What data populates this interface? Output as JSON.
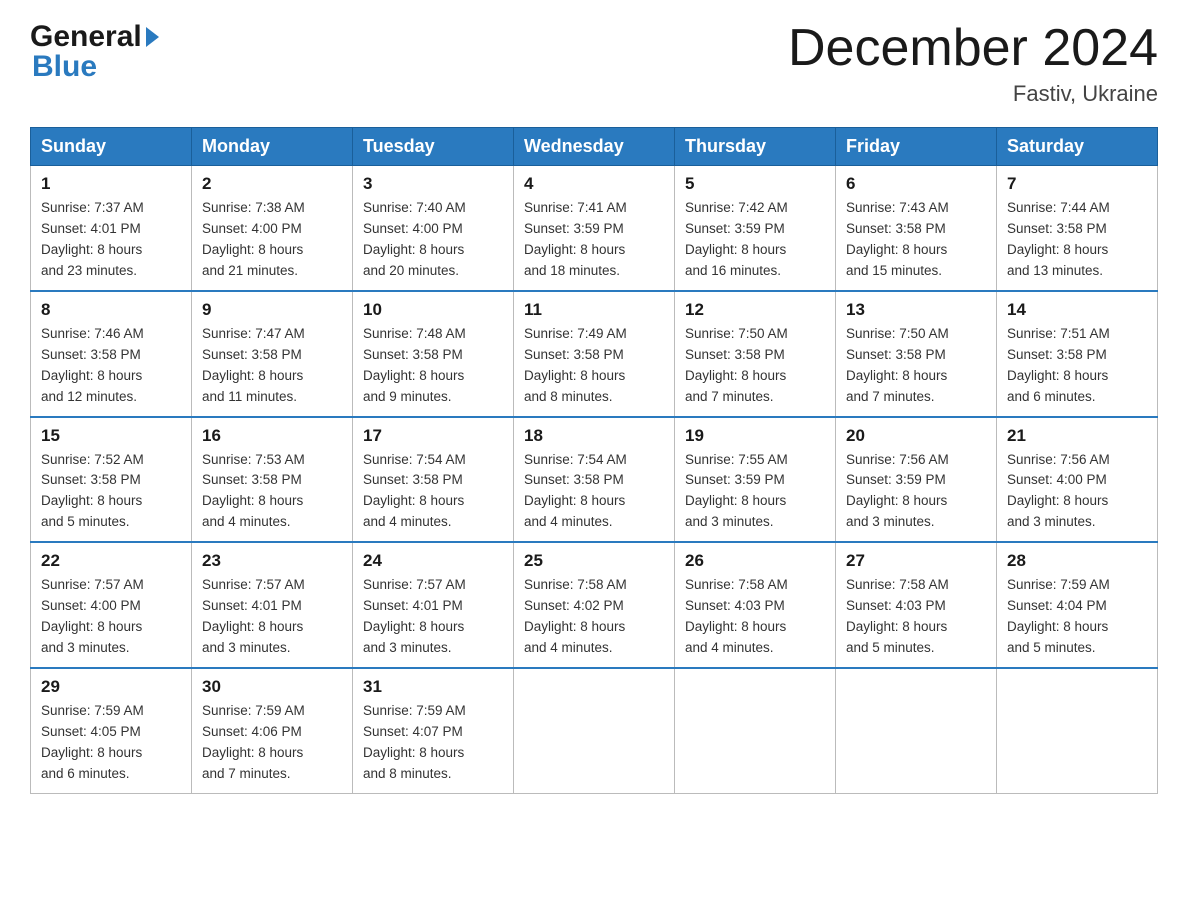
{
  "header": {
    "logo": {
      "general": "General",
      "blue": "Blue",
      "arrow": "▶"
    },
    "title": "December 2024",
    "location": "Fastiv, Ukraine"
  },
  "calendar": {
    "days_of_week": [
      "Sunday",
      "Monday",
      "Tuesday",
      "Wednesday",
      "Thursday",
      "Friday",
      "Saturday"
    ],
    "weeks": [
      [
        {
          "day": "1",
          "sunrise": "7:37 AM",
          "sunset": "4:01 PM",
          "daylight": "8 hours and 23 minutes."
        },
        {
          "day": "2",
          "sunrise": "7:38 AM",
          "sunset": "4:00 PM",
          "daylight": "8 hours and 21 minutes."
        },
        {
          "day": "3",
          "sunrise": "7:40 AM",
          "sunset": "4:00 PM",
          "daylight": "8 hours and 20 minutes."
        },
        {
          "day": "4",
          "sunrise": "7:41 AM",
          "sunset": "3:59 PM",
          "daylight": "8 hours and 18 minutes."
        },
        {
          "day": "5",
          "sunrise": "7:42 AM",
          "sunset": "3:59 PM",
          "daylight": "8 hours and 16 minutes."
        },
        {
          "day": "6",
          "sunrise": "7:43 AM",
          "sunset": "3:58 PM",
          "daylight": "8 hours and 15 minutes."
        },
        {
          "day": "7",
          "sunrise": "7:44 AM",
          "sunset": "3:58 PM",
          "daylight": "8 hours and 13 minutes."
        }
      ],
      [
        {
          "day": "8",
          "sunrise": "7:46 AM",
          "sunset": "3:58 PM",
          "daylight": "8 hours and 12 minutes."
        },
        {
          "day": "9",
          "sunrise": "7:47 AM",
          "sunset": "3:58 PM",
          "daylight": "8 hours and 11 minutes."
        },
        {
          "day": "10",
          "sunrise": "7:48 AM",
          "sunset": "3:58 PM",
          "daylight": "8 hours and 9 minutes."
        },
        {
          "day": "11",
          "sunrise": "7:49 AM",
          "sunset": "3:58 PM",
          "daylight": "8 hours and 8 minutes."
        },
        {
          "day": "12",
          "sunrise": "7:50 AM",
          "sunset": "3:58 PM",
          "daylight": "8 hours and 7 minutes."
        },
        {
          "day": "13",
          "sunrise": "7:50 AM",
          "sunset": "3:58 PM",
          "daylight": "8 hours and 7 minutes."
        },
        {
          "day": "14",
          "sunrise": "7:51 AM",
          "sunset": "3:58 PM",
          "daylight": "8 hours and 6 minutes."
        }
      ],
      [
        {
          "day": "15",
          "sunrise": "7:52 AM",
          "sunset": "3:58 PM",
          "daylight": "8 hours and 5 minutes."
        },
        {
          "day": "16",
          "sunrise": "7:53 AM",
          "sunset": "3:58 PM",
          "daylight": "8 hours and 4 minutes."
        },
        {
          "day": "17",
          "sunrise": "7:54 AM",
          "sunset": "3:58 PM",
          "daylight": "8 hours and 4 minutes."
        },
        {
          "day": "18",
          "sunrise": "7:54 AM",
          "sunset": "3:58 PM",
          "daylight": "8 hours and 4 minutes."
        },
        {
          "day": "19",
          "sunrise": "7:55 AM",
          "sunset": "3:59 PM",
          "daylight": "8 hours and 3 minutes."
        },
        {
          "day": "20",
          "sunrise": "7:56 AM",
          "sunset": "3:59 PM",
          "daylight": "8 hours and 3 minutes."
        },
        {
          "day": "21",
          "sunrise": "7:56 AM",
          "sunset": "4:00 PM",
          "daylight": "8 hours and 3 minutes."
        }
      ],
      [
        {
          "day": "22",
          "sunrise": "7:57 AM",
          "sunset": "4:00 PM",
          "daylight": "8 hours and 3 minutes."
        },
        {
          "day": "23",
          "sunrise": "7:57 AM",
          "sunset": "4:01 PM",
          "daylight": "8 hours and 3 minutes."
        },
        {
          "day": "24",
          "sunrise": "7:57 AM",
          "sunset": "4:01 PM",
          "daylight": "8 hours and 3 minutes."
        },
        {
          "day": "25",
          "sunrise": "7:58 AM",
          "sunset": "4:02 PM",
          "daylight": "8 hours and 4 minutes."
        },
        {
          "day": "26",
          "sunrise": "7:58 AM",
          "sunset": "4:03 PM",
          "daylight": "8 hours and 4 minutes."
        },
        {
          "day": "27",
          "sunrise": "7:58 AM",
          "sunset": "4:03 PM",
          "daylight": "8 hours and 5 minutes."
        },
        {
          "day": "28",
          "sunrise": "7:59 AM",
          "sunset": "4:04 PM",
          "daylight": "8 hours and 5 minutes."
        }
      ],
      [
        {
          "day": "29",
          "sunrise": "7:59 AM",
          "sunset": "4:05 PM",
          "daylight": "8 hours and 6 minutes."
        },
        {
          "day": "30",
          "sunrise": "7:59 AM",
          "sunset": "4:06 PM",
          "daylight": "8 hours and 7 minutes."
        },
        {
          "day": "31",
          "sunrise": "7:59 AM",
          "sunset": "4:07 PM",
          "daylight": "8 hours and 8 minutes."
        },
        null,
        null,
        null,
        null
      ]
    ],
    "labels": {
      "sunrise": "Sunrise:",
      "sunset": "Sunset:",
      "daylight": "Daylight:"
    }
  }
}
